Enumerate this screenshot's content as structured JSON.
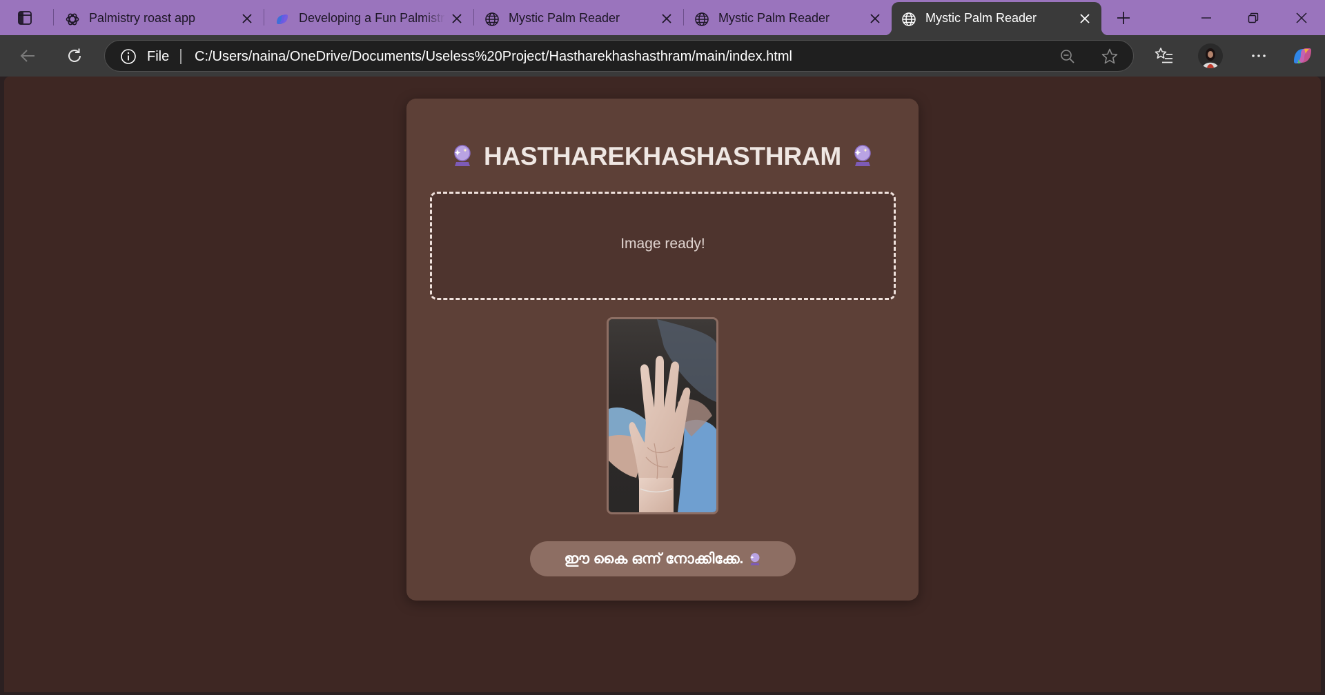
{
  "browser": {
    "tabs": [
      {
        "title": "Palmistry roast app",
        "icon": "chatgpt-icon",
        "active": false
      },
      {
        "title": "Developing a Fun Palmistry",
        "icon": "copilot-icon",
        "active": false
      },
      {
        "title": "Mystic Palm Reader",
        "icon": "globe-icon",
        "active": false
      },
      {
        "title": "Mystic Palm Reader",
        "icon": "globe-icon",
        "active": false
      },
      {
        "title": "Mystic Palm Reader",
        "icon": "globe-icon",
        "active": true
      }
    ],
    "address": {
      "scheme": "File",
      "url": "C:/Users/naina/OneDrive/Documents/Useless%20Project/Hastharekhashasthram/main/index.html"
    },
    "colors": {
      "tab_strip": "#9a74bd",
      "toolbar": "#3a3a3a"
    }
  },
  "page": {
    "title": "HASTHAREKHASHASTHRAM",
    "title_emoji": "crystal-ball-icon",
    "upload_status": "Image ready!",
    "preview_image": "palm-photo",
    "read_button": "ഈ കൈ ഒന്ന് നോക്കിക്കേ.",
    "colors": {
      "background": "#3e2723",
      "card": "#5d4037",
      "button": "#8d6e63"
    }
  }
}
